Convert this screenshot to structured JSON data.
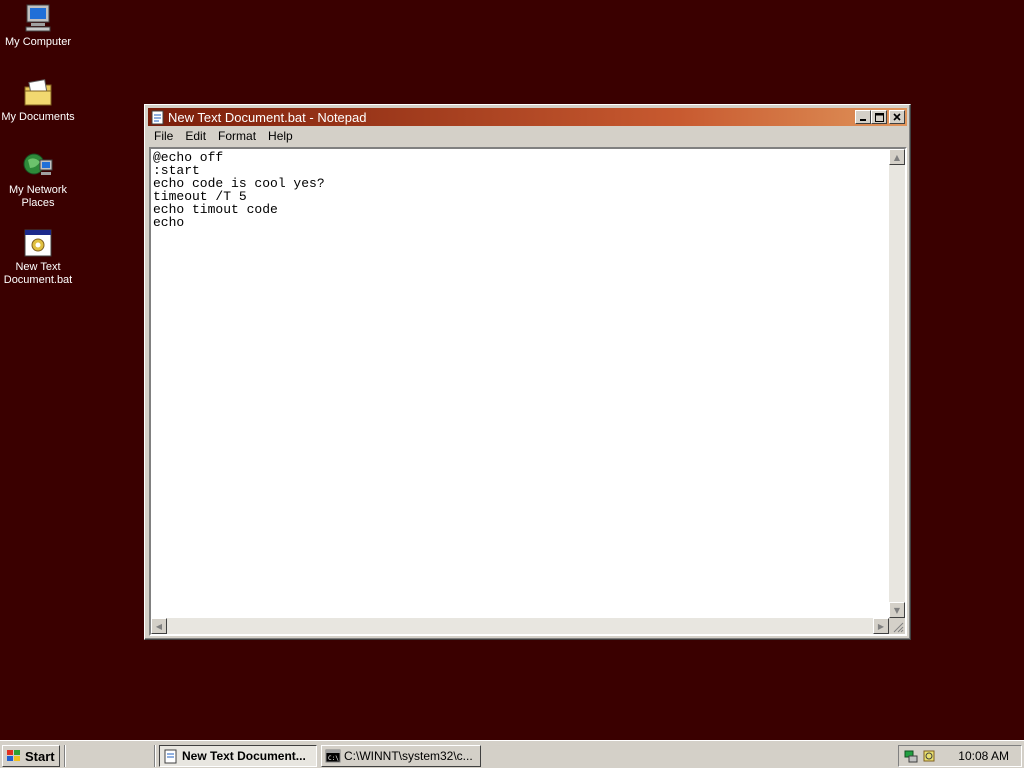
{
  "desktop": {
    "icons": [
      {
        "label": "My Computer"
      },
      {
        "label": "My Documents"
      },
      {
        "label": "My Network Places"
      },
      {
        "label": "New Text Document.bat"
      }
    ]
  },
  "window": {
    "title": "New Text Document.bat - Notepad",
    "menu": [
      "File",
      "Edit",
      "Format",
      "Help"
    ],
    "content": "@echo off\n:start\necho code is cool yes?\ntimeout /T 5\necho timout code\necho"
  },
  "taskbar": {
    "start_label": "Start",
    "tasks": [
      {
        "label": "New Text Document..."
      },
      {
        "label": "C:\\WINNT\\system32\\c..."
      }
    ],
    "clock": "10:08 AM"
  },
  "colors": {
    "desktop": "#3a0000",
    "titlebar_start": "#7a1d0a",
    "titlebar_end": "#e0945a",
    "chrome": "#d4d0c8"
  }
}
